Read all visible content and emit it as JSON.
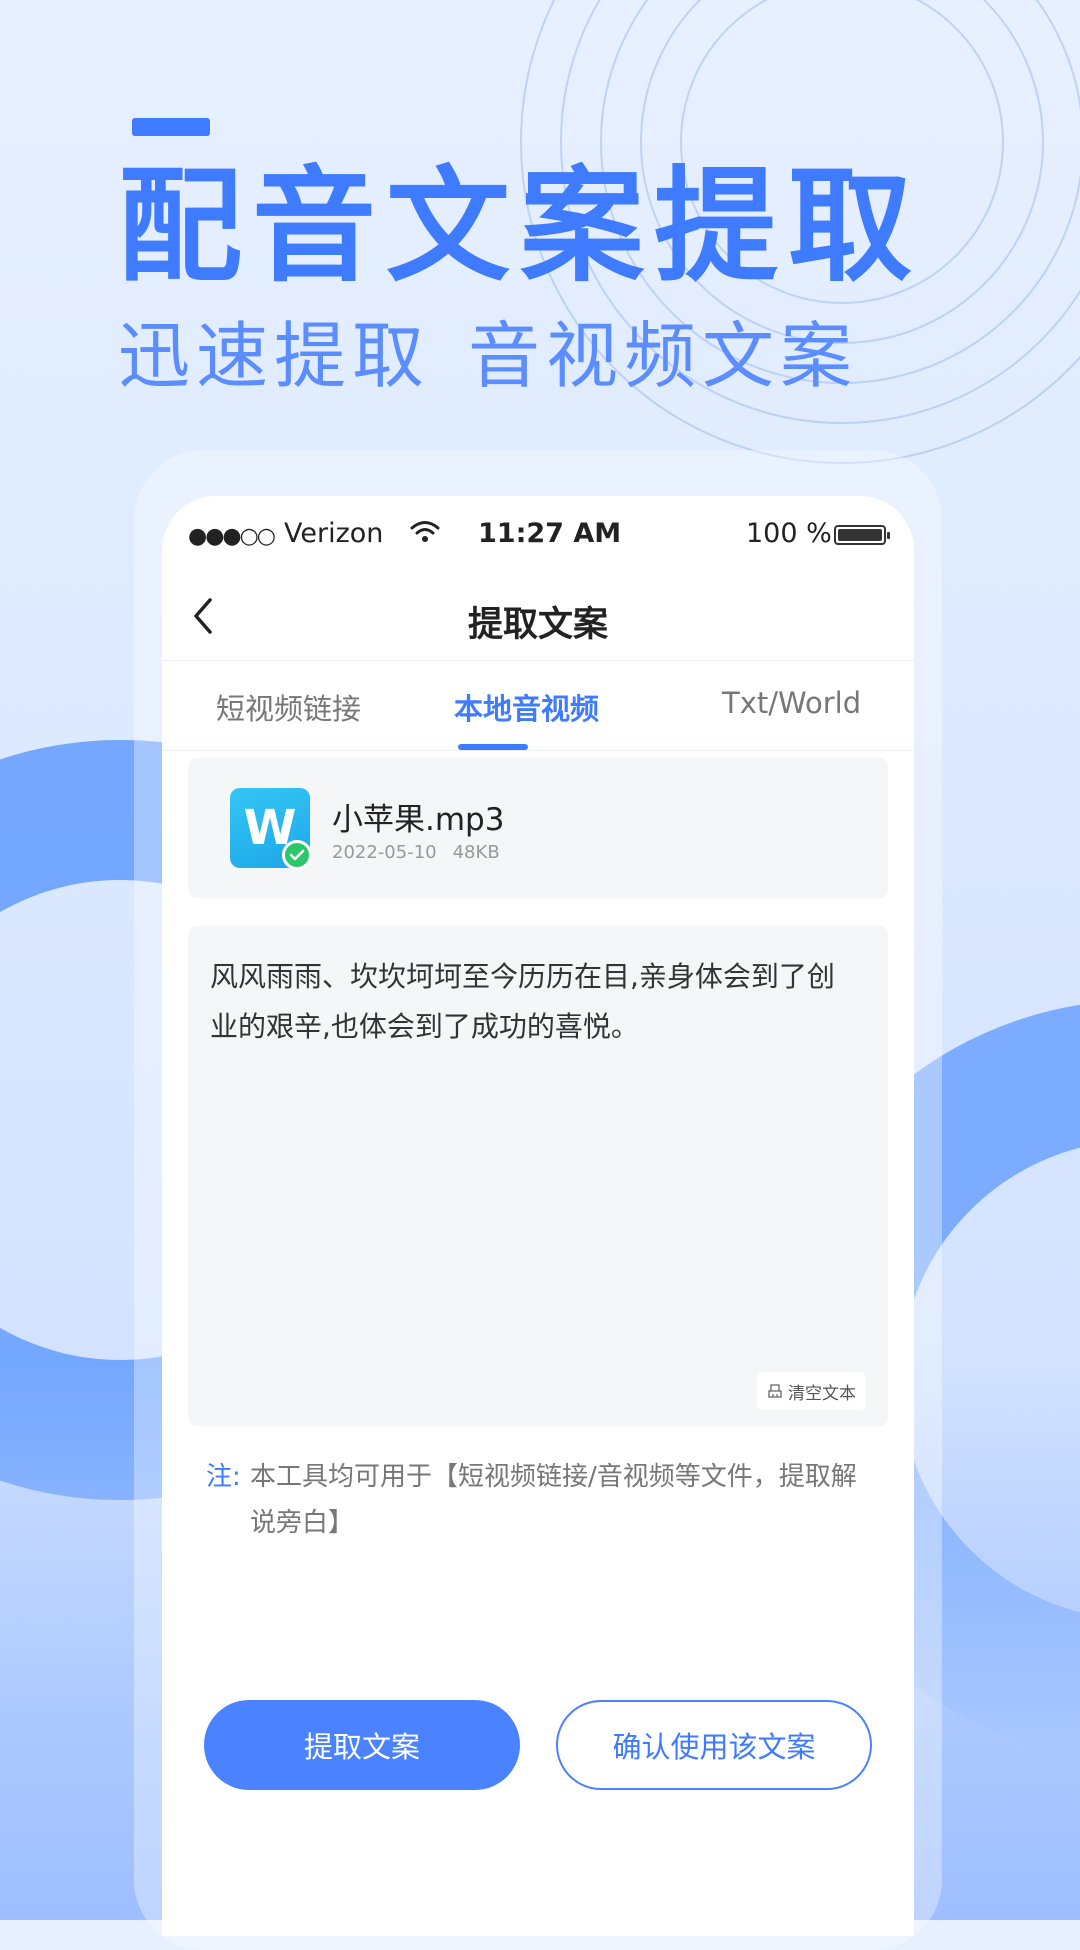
{
  "promo": {
    "headline": "配音文案提取",
    "subhead_left": "迅速提取",
    "subhead_right": "音视频文案"
  },
  "statusbar": {
    "signal": "●●●○○",
    "carrier": "Verizon",
    "time": "11:27 AM",
    "battery": "100 %"
  },
  "navbar": {
    "title": "提取文案"
  },
  "tabs": [
    {
      "label": "短视频链接",
      "active": false
    },
    {
      "label": "本地音视频",
      "active": true
    },
    {
      "label": "Txt/World",
      "active": false
    }
  ],
  "file": {
    "icon_letter": "W",
    "name": "小苹果.mp3",
    "date": "2022-05-10",
    "size": "48KB"
  },
  "text_box": {
    "content": "风风雨雨、坎坎坷坷至今历历在目,亲身体会到了创业的艰辛,也体会到了成功的喜悦。",
    "clear_label": "清空文本"
  },
  "note": {
    "label": "注:",
    "text": "本工具均可用于【短视频链接/音视频等文件，提取解说旁白】"
  },
  "buttons": {
    "extract": "提取文案",
    "confirm": "确认使用该文案"
  },
  "colors": {
    "accent": "#3f7bff",
    "button": "#4a82ff",
    "success": "#2cc66b"
  }
}
